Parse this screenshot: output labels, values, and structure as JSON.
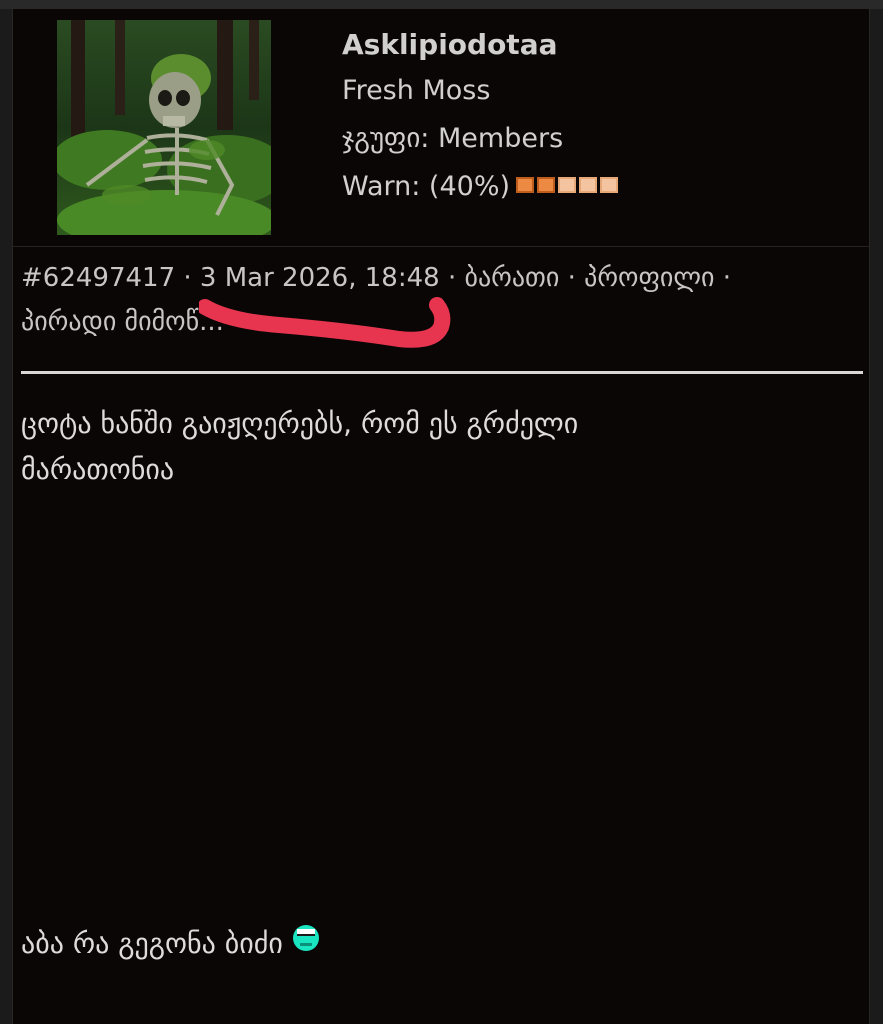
{
  "user": {
    "username": "Asklipiodotaa",
    "rank": "Fresh Moss",
    "group_label": "ჯგუფი:",
    "group_value": "Members",
    "warn_label": "Warn: (40%)",
    "warn_level": 0.4,
    "colors": {
      "warn_on": "#ec8a44",
      "warn_off": "#f3c49f"
    }
  },
  "post": {
    "id": "#62497417",
    "date": "3 Mar 2026, 18:48",
    "links": [
      "ბარათი",
      "პროფილი",
      "პირადი მიმოწ..."
    ],
    "body_lines": [
      "ცოტა ხანში გაიჟღერებს, რომ ეს გრძელი",
      "მარათონია"
    ],
    "footer": "აბა რა გეგონა ბიძი",
    "emoticon": "cyan-smiley-icon"
  },
  "colors": {
    "background": "#0b0606",
    "text": "#dedbdb",
    "scribble": "#e8354f"
  }
}
